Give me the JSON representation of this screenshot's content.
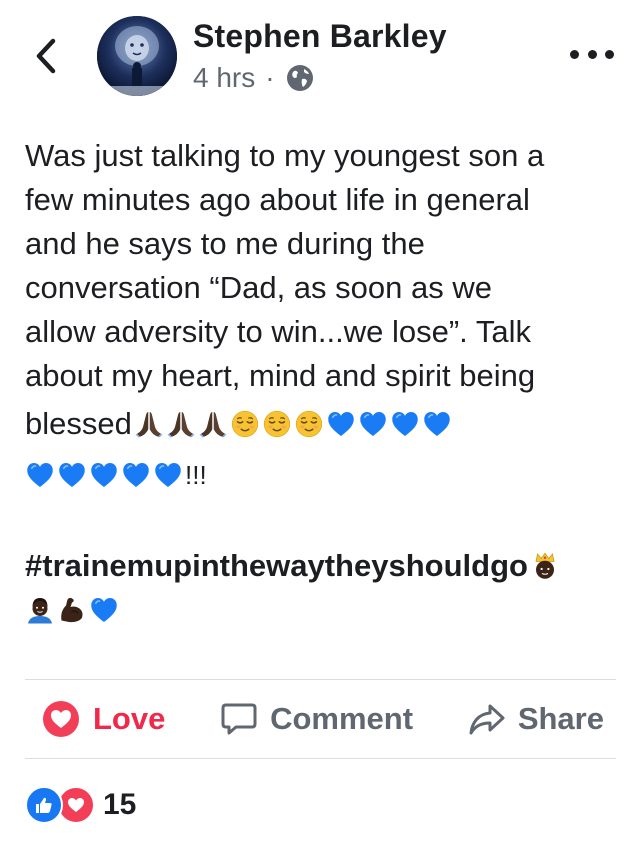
{
  "header": {
    "author_name": "Stephen Barkley",
    "timestamp": "4 hrs",
    "separator": "·",
    "privacy_icon": "globe-icon",
    "back_icon": "chevron-left-icon",
    "more_icon": "more-options-icon"
  },
  "post": {
    "lines": [
      "Was just talking to my youngest son a",
      "few minutes ago about life in general",
      "and he says to me during the",
      "conversation “Dad, as soon as we",
      "allow adversity to win...we lose”. Talk",
      "about my heart, mind and spirit being"
    ],
    "blessed_word": "blessed",
    "emoji_line_1": [
      "praying-hands",
      "praying-hands",
      "praying-hands",
      "relieved-face",
      "relieved-face",
      "relieved-face",
      "blue-heart",
      "blue-heart",
      "blue-heart",
      "blue-heart"
    ],
    "emoji_line_2": [
      "blue-heart",
      "blue-heart",
      "blue-heart",
      "blue-heart",
      "blue-heart"
    ],
    "exclaim": "!!!",
    "hashtag": "#trainemupinthewaytheyshouldgo",
    "hashtag_emoji": [
      "prince",
      "man",
      "flexed-biceps",
      "blue-heart"
    ]
  },
  "actions": {
    "love_label": "Love",
    "comment_label": "Comment",
    "share_label": "Share",
    "love_color": "#f0284a"
  },
  "reactions": {
    "count": "15",
    "icons": [
      "like-icon",
      "love-icon"
    ]
  },
  "colors": {
    "like_blue": "#1877f2",
    "love_red": "#f33e58",
    "heart_blue": "#1a7cf5",
    "meta_gray": "#616770"
  }
}
